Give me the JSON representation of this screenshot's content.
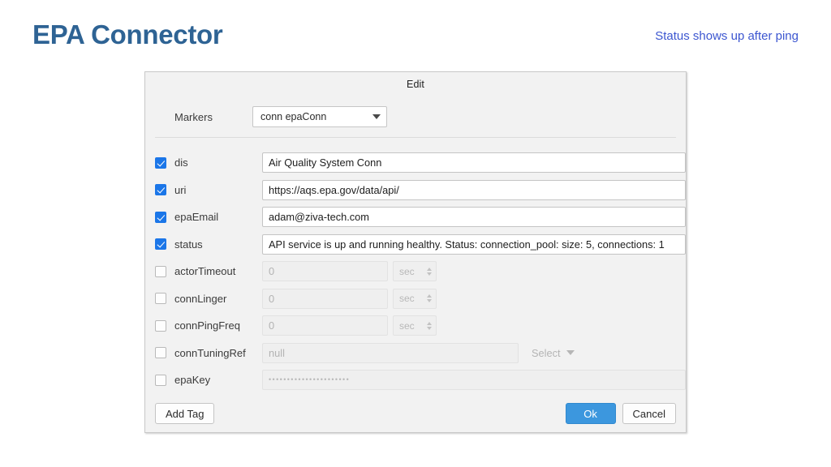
{
  "slide": {
    "title": "EPA Connector",
    "note": "Status shows up after ping",
    "title_color": "#2e6394",
    "note_color": "#3c56d0"
  },
  "dialog": {
    "title": "Edit",
    "markers_label": "Markers",
    "marker_value": "conn  epaConn",
    "fields": [
      {
        "name": "dis",
        "checked": true,
        "value": "Air Quality System Conn",
        "placeholder": "",
        "unit": "",
        "width": "wide"
      },
      {
        "name": "uri",
        "checked": true,
        "value": "https://aqs.epa.gov/data/api/",
        "placeholder": "",
        "unit": "",
        "width": "wide"
      },
      {
        "name": "epaEmail",
        "checked": true,
        "value": "adam@ziva-tech.com",
        "placeholder": "",
        "unit": "",
        "width": "wide"
      },
      {
        "name": "status",
        "checked": true,
        "value": "API service is up and running healthy. Status: connection_pool: size: 5, connections: 1",
        "placeholder": "",
        "unit": "",
        "width": "wide"
      },
      {
        "name": "actorTimeout",
        "checked": false,
        "value": "",
        "placeholder": "0",
        "unit": "sec",
        "width": "narrow"
      },
      {
        "name": "connLinger",
        "checked": false,
        "value": "",
        "placeholder": "0",
        "unit": "sec",
        "width": "narrow"
      },
      {
        "name": "connPingFreq",
        "checked": false,
        "value": "",
        "placeholder": "0",
        "unit": "sec",
        "width": "narrow"
      },
      {
        "name": "connTuningRef",
        "checked": false,
        "value": "",
        "placeholder": "null",
        "unit": "",
        "width": "tune",
        "select_label": "Select"
      },
      {
        "name": "epaKey",
        "checked": false,
        "value": "",
        "placeholder": "",
        "unit": "",
        "width": "key",
        "masked": "••••••••••••••••••••••"
      }
    ],
    "buttons": {
      "add_tag": "Add Tag",
      "ok": "Ok",
      "cancel": "Cancel",
      "ok_color": "#3c97de"
    }
  }
}
